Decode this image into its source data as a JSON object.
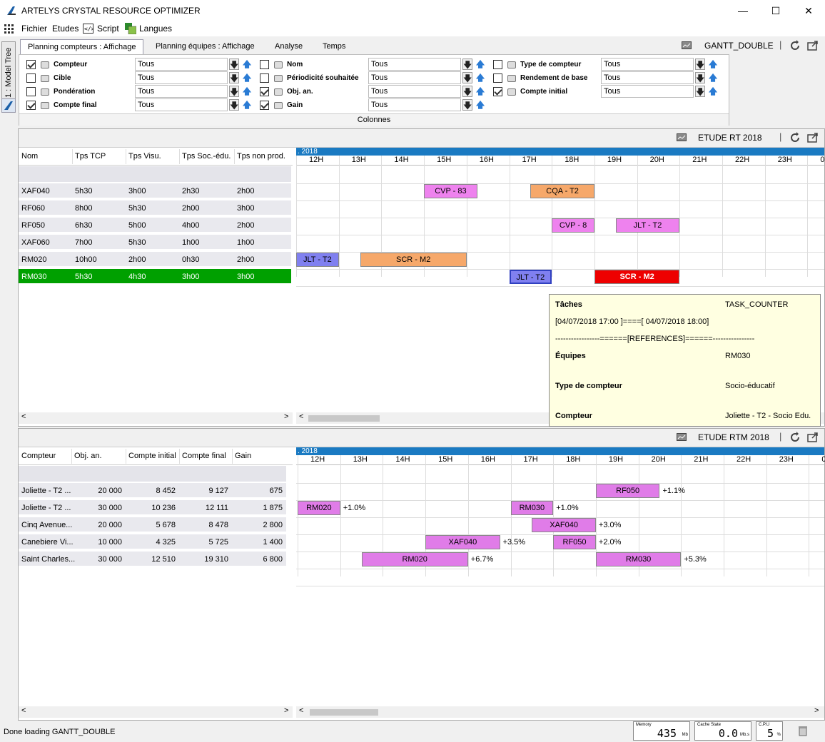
{
  "window": {
    "title": "ARTELYS CRYSTAL RESOURCE OPTIMIZER",
    "minimize": "—",
    "maximize": "☐",
    "close": "✕"
  },
  "menu": [
    "Fichier",
    "Etudes",
    "Script",
    "Langues"
  ],
  "sidetab": "1 : Model Tree",
  "tabs": [
    "Planning compteurs : Affichage",
    "Planning équipes : Affichage",
    "Analyse",
    "Temps"
  ],
  "view_name": "GANTT_DOUBLE",
  "filters": {
    "col1": [
      {
        "label": "Compteur",
        "checked": true,
        "value": "Tous"
      },
      {
        "label": "Cible",
        "checked": false,
        "value": "Tous"
      },
      {
        "label": "Pondération",
        "checked": false,
        "value": "Tous"
      },
      {
        "label": "Compte final",
        "checked": true,
        "value": "Tous"
      }
    ],
    "col2": [
      {
        "label": "Nom",
        "checked": false,
        "value": "Tous"
      },
      {
        "label": "Périodicité souhaitée",
        "checked": false,
        "value": "Tous"
      },
      {
        "label": "Obj. an.",
        "checked": true,
        "value": "Tous"
      },
      {
        "label": "Gain",
        "checked": true,
        "value": "Tous"
      }
    ],
    "col3": [
      {
        "label": "Type de compteur",
        "checked": false,
        "value": "Tous"
      },
      {
        "label": "Rendement de base",
        "checked": false,
        "value": "Tous"
      },
      {
        "label": "Compte initial",
        "checked": true,
        "value": "Tous"
      }
    ],
    "colonnes": "Colonnes"
  },
  "top": {
    "study": "ETUDE RT 2018",
    "year": ". 2018",
    "headers": [
      "Nom",
      "Tps TCP",
      "Tps Visu.",
      "Tps Soc.-édu.",
      "Tps non prod."
    ],
    "rows": [
      [
        "XAF040",
        "5h30",
        "3h00",
        "2h30",
        "2h00"
      ],
      [
        "RF060",
        "8h00",
        "5h30",
        "2h00",
        "3h00"
      ],
      [
        "RF050",
        "6h30",
        "5h00",
        "4h00",
        "2h00"
      ],
      [
        "XAF060",
        "7h00",
        "5h30",
        "1h00",
        "1h00"
      ],
      [
        "RM020",
        "10h00",
        "2h00",
        "0h30",
        "2h00"
      ],
      [
        "RM030",
        "5h30",
        "4h30",
        "3h00",
        "3h00"
      ]
    ],
    "bars": [
      {
        "row": 0,
        "start": 15.0,
        "end": 16.25,
        "label": "CVP - 83",
        "color": "#ee82ee"
      },
      {
        "row": 0,
        "start": 17.5,
        "end": 19.0,
        "label": "CQA - T2",
        "color": "#f6a86a"
      },
      {
        "row": 2,
        "start": 18.0,
        "end": 19.0,
        "label": "CVP - 8",
        "color": "#ee82ee"
      },
      {
        "row": 2,
        "start": 19.5,
        "end": 21.0,
        "label": "JLT - T2",
        "color": "#ee82ee"
      },
      {
        "row": 4,
        "start": 12.0,
        "end": 13.0,
        "label": "JLT - T2",
        "color": "#8080f0"
      },
      {
        "row": 4,
        "start": 13.5,
        "end": 16.0,
        "label": "SCR - M2",
        "color": "#f6a86a"
      },
      {
        "row": 5,
        "start": 17.0,
        "end": 18.0,
        "label": "JLT - T2",
        "color": "#8080f0"
      },
      {
        "row": 5,
        "start": 19.0,
        "end": 21.0,
        "label": "SCR - M2",
        "color": "#ee0000"
      }
    ]
  },
  "hours": [
    "12H",
    "13H",
    "14H",
    "15H",
    "16H",
    "17H",
    "18H",
    "19H",
    "20H",
    "21H",
    "22H",
    "23H",
    "0"
  ],
  "tooltip": {
    "l1": "Tâches",
    "r1": "TASK_COUNTER",
    "dates": "[04/07/2018 17:00 ]====[ 04/07/2018 18:00]",
    "refs": "-----------------======[REFERENCES]======----------------",
    "l2": "Équipes",
    "r2": "RM030",
    "l3": "Type de compteur",
    "r3": "Socio-éducatif",
    "l4": "Compteur",
    "r4": "Joliette - T2 - Socio Edu."
  },
  "bottom": {
    "study": "ETUDE RTM 2018",
    "year": ". 2018",
    "headers": [
      "Compteur",
      "Obj. an.",
      "Compte initial",
      "Compte final",
      "Gain"
    ],
    "rows": [
      [
        "Joliette - T2 ...",
        "20 000",
        "8 452",
        "9 127",
        "675"
      ],
      [
        "Joliette - T2 ...",
        "30 000",
        "10 236",
        "12 111",
        "1 875"
      ],
      [
        "Cinq Avenue...",
        "20 000",
        "5 678",
        "8 478",
        "2 800"
      ],
      [
        "Canebiere Vi...",
        "10 000",
        "4 325",
        "5 725",
        "1 400"
      ],
      [
        "Saint Charles...",
        "30 000",
        "12 510",
        "19 310",
        "6 800"
      ]
    ],
    "bars": [
      {
        "row": 0,
        "start": 19.0,
        "end": 20.5,
        "label": "RF050",
        "pct": "+1.1%"
      },
      {
        "row": 1,
        "start": 12.0,
        "end": 13.0,
        "label": "RM020",
        "pct": "+1.0%"
      },
      {
        "row": 1,
        "start": 17.0,
        "end": 18.0,
        "label": "RM030",
        "pct": "+1.0%"
      },
      {
        "row": 2,
        "start": 17.5,
        "end": 19.0,
        "label": "XAF040",
        "pct": "+3.0%"
      },
      {
        "row": 3,
        "start": 15.0,
        "end": 16.75,
        "label": "XAF040",
        "pct": "+3.5%"
      },
      {
        "row": 3,
        "start": 18.0,
        "end": 19.0,
        "label": "RF050",
        "pct": "+2.0%"
      },
      {
        "row": 4,
        "start": 13.5,
        "end": 16.0,
        "label": "RM020",
        "pct": "+6.7%"
      },
      {
        "row": 4,
        "start": 19.0,
        "end": 21.0,
        "label": "RM030",
        "pct": "+5.3%"
      }
    ]
  },
  "status": "Done loading GANTT_DOUBLE",
  "meters": [
    {
      "label": "Memory",
      "value": "435",
      "unit": "Mb"
    },
    {
      "label": "Cache State",
      "value": "0.0",
      "unit": "Mb.s"
    },
    {
      "label": "C.P.U",
      "value": "5",
      "unit": "%"
    }
  ]
}
